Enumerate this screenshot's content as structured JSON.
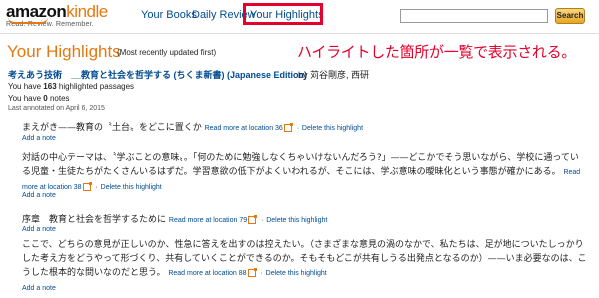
{
  "header": {
    "logo_amazon": "amazon",
    "logo_kindle": "kindle",
    "tagline": "Read. Review. Remember.",
    "nav": {
      "your_books": "Your Books",
      "daily_review": "Daily Review",
      "your_highlights": "Your Highlights"
    },
    "search_placeholder": "",
    "search_button": "Search"
  },
  "page": {
    "title": "Your Highlights",
    "subtitle": "(Most recently updated first)",
    "annotation": "ハイライトした箇所が一覧で表示される。"
  },
  "book": {
    "title": "考えあう技術　__教育と社会を哲学する (ちくま新書) (Japanese Edition)",
    "author": "by 苅谷剛彦, 西研",
    "you_have_prefix": "You have ",
    "highlights_count": "163",
    "highlights_suffix": " highlighted passages",
    "notes_count": "0",
    "notes_suffix": " notes",
    "last_annotated": "Last annotated on April 6, 2015"
  },
  "highlights": [
    {
      "text": "まえがき——教育の〝土台〟をどこに置くか",
      "read_more": "Read more at location 36",
      "delete": "Delete this highlight",
      "add_note": "Add a note"
    },
    {
      "text": "対話の中心テーマは、〝学ぶことの意味〟。「何のために勉強しなくちゃいけないんだろう?」——どこかでそう思いながら、学校に通っている児童・生徒たちがたくさんいるはずだ。学習意欲の低下がよくいわれるが、そこには、学ぶ意味の曖昧化という事態が確かにある。",
      "read_more": "Read more at location 38",
      "delete": "Delete this highlight",
      "add_note": "Add a note"
    },
    {
      "text": "序章　教育と社会を哲学するために",
      "read_more": "Read more at location 79",
      "delete": "Delete this highlight",
      "add_note": "Add a note"
    },
    {
      "text": "ここで、どちらの意見が正しいのか、性急に答えを出すのは控えたい。（さまざまな意見の渦のなかで、私たちは、足が地についたしっかりした考え方をどうやって形づくり、共有していくことができるのか。そもそもどこが共有しうる出発点となるのか）——いま必要なのは、こうした根本的な問いなのだと思う。",
      "read_more": "Read more at location 88",
      "delete": "Delete this highlight",
      "add_note": "Add a note"
    }
  ],
  "colors": {
    "brand_orange": "#e47911",
    "link_blue": "#004b91",
    "annotation_red": "#e4002b"
  }
}
